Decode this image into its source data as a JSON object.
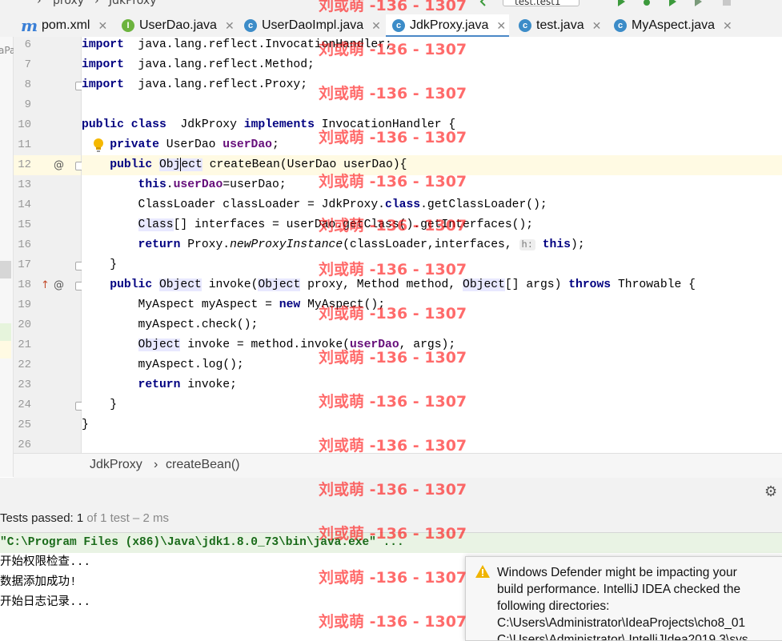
{
  "navbar": {
    "module": "proxy",
    "class_name": "JdkProxy",
    "run_config": "test.test1"
  },
  "tabs": [
    {
      "label": "pom.xml",
      "icon": "m"
    },
    {
      "label": "UserDao.java",
      "icon": "I"
    },
    {
      "label": "UserDaoImpl.java",
      "icon": "c"
    },
    {
      "label": "JdkProxy.java",
      "icon": "c",
      "active": true
    },
    {
      "label": "test.java",
      "icon": "c"
    },
    {
      "label": "MyAspect.java",
      "icon": "c"
    }
  ],
  "left_panel_fragment": "aPa",
  "editor": {
    "lines": [
      {
        "n": "6",
        "parts": [
          [
            "kw",
            "import"
          ],
          [
            "",
            "  java.lang.reflect.InvocationHandler;"
          ]
        ]
      },
      {
        "n": "7",
        "parts": [
          [
            "kw",
            "import"
          ],
          [
            "",
            "  java.lang.reflect.Method;"
          ]
        ]
      },
      {
        "n": "8",
        "parts": [
          [
            "kw",
            "import"
          ],
          [
            "",
            "  java.lang.reflect.Proxy;"
          ]
        ]
      },
      {
        "n": "9",
        "parts": []
      },
      {
        "n": "10",
        "parts": [
          [
            "kw",
            "public class"
          ],
          [
            "",
            "  JdkProxy "
          ],
          [
            "kw",
            "implements"
          ],
          [
            "",
            " InvocationHandler {"
          ]
        ]
      },
      {
        "n": "11",
        "parts": [
          [
            "",
            "    "
          ],
          [
            "kw",
            "private"
          ],
          [
            "",
            " UserDao "
          ],
          [
            "fld",
            "userDao"
          ],
          [
            "",
            ";"
          ]
        ]
      },
      {
        "n": "12",
        "parts": [
          [
            "",
            "    "
          ],
          [
            "kw",
            "public"
          ],
          [
            "",
            " "
          ],
          [
            "hl",
            "Obj"
          ],
          [
            "caret",
            ""
          ],
          [
            "hl",
            "ect"
          ],
          [
            "",
            " createBean(UserDao userDao){"
          ]
        ]
      },
      {
        "n": "13",
        "parts": [
          [
            "",
            "        "
          ],
          [
            "kw",
            "this"
          ],
          [
            "",
            "."
          ],
          [
            "fld",
            "userDao"
          ],
          [
            "",
            "=userDao;"
          ]
        ]
      },
      {
        "n": "14",
        "parts": [
          [
            "",
            "        ClassLoader classLoader = JdkProxy."
          ],
          [
            "kw",
            "class"
          ],
          [
            "",
            ".getClassLoader();"
          ]
        ]
      },
      {
        "n": "15",
        "parts": [
          [
            "",
            "        "
          ],
          [
            "hl",
            "Class"
          ],
          [
            "",
            "[] interfaces = userDao.getClass().getInterfaces();"
          ]
        ]
      },
      {
        "n": "16",
        "parts": [
          [
            "",
            "        "
          ],
          [
            "kw",
            "return"
          ],
          [
            "",
            " Proxy."
          ],
          [
            "it",
            "newProxyInstance"
          ],
          [
            "",
            "(classLoader,interfaces, "
          ],
          [
            "hint",
            "h:"
          ],
          [
            "",
            " "
          ],
          [
            "kw",
            "this"
          ],
          [
            "",
            ");"
          ]
        ]
      },
      {
        "n": "17",
        "parts": [
          [
            "",
            "    }"
          ]
        ]
      },
      {
        "n": "18",
        "parts": [
          [
            "",
            "    "
          ],
          [
            "kw",
            "public"
          ],
          [
            "",
            " "
          ],
          [
            "hl",
            "Object"
          ],
          [
            "",
            " invoke("
          ],
          [
            "hl",
            "Object"
          ],
          [
            "",
            " proxy, Method method, "
          ],
          [
            "hl",
            "Object"
          ],
          [
            "",
            "[] args) "
          ],
          [
            "kw",
            "throws"
          ],
          [
            "",
            " Throwable {"
          ]
        ]
      },
      {
        "n": "19",
        "parts": [
          [
            "",
            "        MyAspect myAspect = "
          ],
          [
            "kw",
            "new"
          ],
          [
            "",
            " MyAspect();"
          ]
        ]
      },
      {
        "n": "20",
        "parts": [
          [
            "",
            "        myAspect.check();"
          ]
        ]
      },
      {
        "n": "21",
        "parts": [
          [
            "",
            "        "
          ],
          [
            "hl",
            "Object"
          ],
          [
            "",
            " invoke = method.invoke("
          ],
          [
            "fld",
            "userDao"
          ],
          [
            "",
            ", args);"
          ]
        ]
      },
      {
        "n": "22",
        "parts": [
          [
            "",
            "        myAspect.log();"
          ]
        ]
      },
      {
        "n": "23",
        "parts": [
          [
            "",
            "        "
          ],
          [
            "kw",
            "return"
          ],
          [
            "",
            " invoke;"
          ]
        ]
      },
      {
        "n": "24",
        "parts": [
          [
            "",
            "    }"
          ]
        ]
      },
      {
        "n": "25",
        "parts": [
          [
            "",
            "}"
          ]
        ]
      },
      {
        "n": "26",
        "parts": []
      }
    ]
  },
  "breadcrumb": {
    "class_name": "JdkProxy",
    "sep": "›",
    "method": "createBean()"
  },
  "run": {
    "status_prefix": "Tests passed: ",
    "passed": "1",
    "status_suffix": " of 1 test – 2 ms",
    "console": [
      "\"C:\\Program Files (x86)\\Java\\jdk1.8.0_73\\bin\\java.exe\" ...",
      "开始权限检查...",
      "数据添加成功!",
      "开始日志记录..."
    ]
  },
  "notification": {
    "line1": "Windows Defender might be impacting your",
    "line2": "build performance. IntelliJ IDEA checked the",
    "line3": "following directories:",
    "path1": "C:\\Users\\Administrator\\IdeaProjects\\cho8_01",
    "path2": "C:\\Users\\Administrator\\.IntelliJIdea2019.3\\sys"
  },
  "watermark": "刘或萌 -136 - 1307",
  "colors": {
    "keyword": "#000080",
    "field": "#660e7a",
    "tab_accent": "#4a88c7",
    "watermark": "#ff0000"
  }
}
